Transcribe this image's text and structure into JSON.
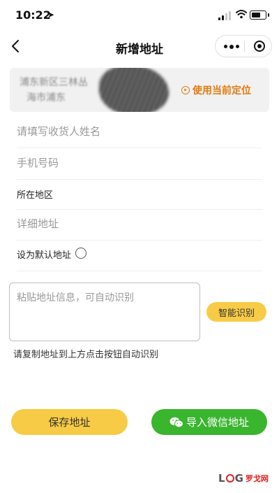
{
  "status_bar": {
    "time": "10:22",
    "location_arrow": "➤"
  },
  "nav": {
    "title": "新增地址"
  },
  "location_card": {
    "blurred_line1": "浦东新区三林丛",
    "blurred_line2": "海市浦东",
    "use_location_label": "使用当前定位"
  },
  "form": {
    "name_placeholder": "请填写收货人姓名",
    "phone_placeholder": "手机号码",
    "region_label": "所在地区",
    "detail_placeholder": "详细地址",
    "default_label": "设为默认地址"
  },
  "paste": {
    "placeholder": "粘贴地址信息，可自动识别",
    "smart_button": "智能识别",
    "hint": "请复制地址到上方点击按钮自动识别"
  },
  "actions": {
    "save_label": "保存地址",
    "import_wechat_label": "导入微信地址"
  },
  "watermark": {
    "l": "L",
    "g": "G",
    "cn": "罗戈网"
  },
  "colors": {
    "accent_yellow": "#f7cb45",
    "wechat_green": "#39b52e",
    "location_orange": "#e07a10"
  }
}
